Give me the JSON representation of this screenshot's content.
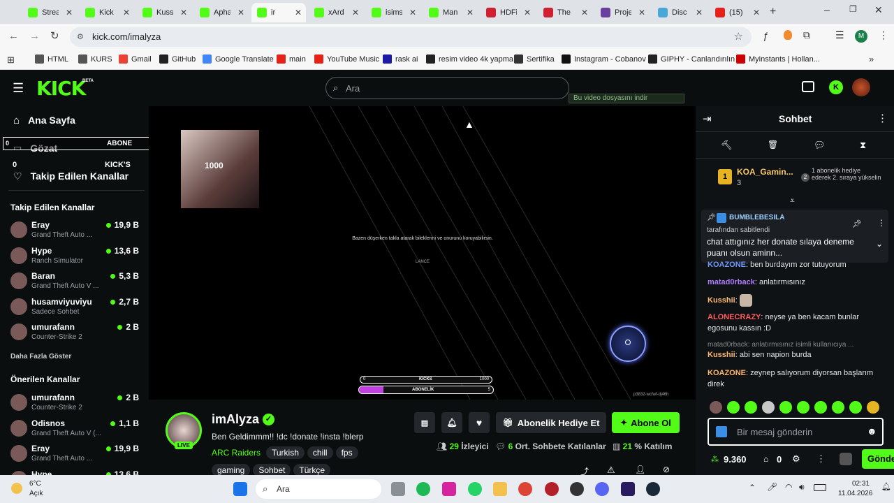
{
  "browser": {
    "tabs": [
      {
        "label": "Strea",
        "color": "#53fc18"
      },
      {
        "label": "Kick",
        "color": "#53fc18"
      },
      {
        "label": "Kussl",
        "color": "#53fc18"
      },
      {
        "label": "Apha",
        "color": "#53fc18"
      },
      {
        "label": "ir",
        "color": "#53fc18"
      },
      {
        "label": "xArd",
        "color": "#53fc18"
      },
      {
        "label": "isims",
        "color": "#53fc18"
      },
      {
        "label": "Man",
        "color": "#53fc18"
      },
      {
        "label": "HDFi",
        "color": "#d01f2f"
      },
      {
        "label": "The",
        "color": "#d01f2f"
      },
      {
        "label": "Proje",
        "color": "#6b3fa0"
      },
      {
        "label": "Disc",
        "color": "#4aa8d8"
      },
      {
        "label": "(15)",
        "color": "#e62117"
      }
    ],
    "url": "kick.com/imalyza",
    "profile_letter": "M",
    "bookmarks": [
      "HTML",
      "KURS",
      "Gmail",
      "GitHub",
      "Google Translate",
      "main",
      "YouTube Music",
      "rask ai",
      "resim video 4k yapma",
      "Sertifika",
      "Instagram - Cobanov",
      "GIPHY - Canlandırılın",
      "Myinstants | Hollan..."
    ]
  },
  "kick": {
    "logo": "KICK",
    "logo_badge": "BETA",
    "search_placeholder": "Ara",
    "download_bar": "Bu video dosyasını indir",
    "sidebar": {
      "home": "Ana Sayfa",
      "browse": "Gözat",
      "following": "Takip Edilen Kanallar",
      "overlay_abone": "ABONE",
      "overlay_left": "0",
      "overlay_right": "5",
      "overlay_kicks": "KICK'S",
      "overlay_kicks_num": "0",
      "overlay_1000": "1000",
      "followed_title": "Takip Edilen Kanallar",
      "followed": [
        {
          "name": "Eray",
          "game": "Grand Theft Auto ...",
          "viewers": "19,9 B"
        },
        {
          "name": "Hype",
          "game": "Ranch Simulator",
          "viewers": "13,6 B"
        },
        {
          "name": "Baran",
          "game": "Grand Theft Auto V ...",
          "viewers": "5,3 B"
        },
        {
          "name": "husamviyuviyu",
          "game": "Sadece Sohbet",
          "viewers": "2,7 B"
        },
        {
          "name": "umurafann",
          "game": "Counter-Strike 2",
          "viewers": "2 B"
        }
      ],
      "show_more": "Daha Fazla Göster",
      "recommended_title": "Önerilen Kanallar",
      "recommended": [
        {
          "name": "umurafann",
          "game": "Counter-Strike 2",
          "viewers": "2 B"
        },
        {
          "name": "Odisnos",
          "game": "Grand Theft Auto V (...",
          "viewers": "1,1 B"
        },
        {
          "name": "Eray",
          "game": "Grand Theft Auto ...",
          "viewers": "19,9 B"
        },
        {
          "name": "Hype",
          "game": "",
          "viewers": "13,6 B"
        }
      ]
    },
    "video": {
      "caption": "Bazen düşerken takla atarak bileklerini ve onurunu koruyabilirsin.",
      "sub": "LANCE",
      "kicks_label": "KICKS",
      "kicks_left": "0",
      "kicks_right": "1000",
      "sub_label": "ABONELİK",
      "sub_right": "5",
      "sub_progress": 0.18,
      "id_text": "p3832-wcfwf-dj46h"
    },
    "stream": {
      "name": "imAlyza",
      "live": "LIVE",
      "title": "Ben Geldimmm!! !dc !donate !insta !blerp",
      "category": "ARC Raiders",
      "tags1": [
        "Turkish",
        "chill",
        "fps"
      ],
      "tags2": [
        "gaming",
        "Sohbet",
        "Türkçe"
      ],
      "gift_btn": "Abonelik Hediye Et",
      "sub_btn": "Abone Ol",
      "viewers": "29",
      "viewers_label": "İzleyici",
      "chatters": "6",
      "chatters_label": "Ort. Sohbete Katılanlar",
      "participation": "21",
      "participation_label": "% Katılım"
    },
    "chat": {
      "title": "Sohbet",
      "leader_name": "KOA_Gamin...",
      "leader_count": "3",
      "leader_rank": "1",
      "gift_rank": "2",
      "gift_text": "1 abonelik hediye ederek 2. sıraya yükselin",
      "pinned_user": "BUMBLEBESILA",
      "pinned_by": "tarafından sabitlendi",
      "pinned_text": "chat attıgınız her donate sılaya deneme puanı olsun aminn...",
      "messages": [
        {
          "user": "KOAZONE",
          "color": "#6f9bff",
          "text": "ben burdayım zor tutuyorum"
        },
        {
          "user": "matad0rback",
          "color": "#b07cff",
          "text": "anlatırmısınız"
        },
        {
          "user": "Kusshii",
          "color": "#ffb86c",
          "text": ""
        },
        {
          "user": "ALONECRAZY",
          "color": "#ff5d5d",
          "text": "neyse ya ben kacam bunlar egosunu kassın :D"
        },
        {
          "user": "",
          "color": "#888888",
          "text": "matad0rback: anlatırmısınız isimli kullanıcıya ..."
        },
        {
          "user": "Kusshii",
          "color": "#ffb86c",
          "text": "abi sen napion burda"
        },
        {
          "user": "KOAZONE",
          "color": "#ffb86c",
          "text": "zeynep salıyorum diyorsan başlarım direk"
        }
      ],
      "input_placeholder": "Bir mesaj gönderin",
      "points": "9.360",
      "inventory": "0",
      "send": "Gönder"
    }
  },
  "taskbar": {
    "weather_temp": "6°C",
    "weather_desc": "Açık",
    "search": "Ara",
    "time": "02:31",
    "date": "11.04.2026"
  }
}
